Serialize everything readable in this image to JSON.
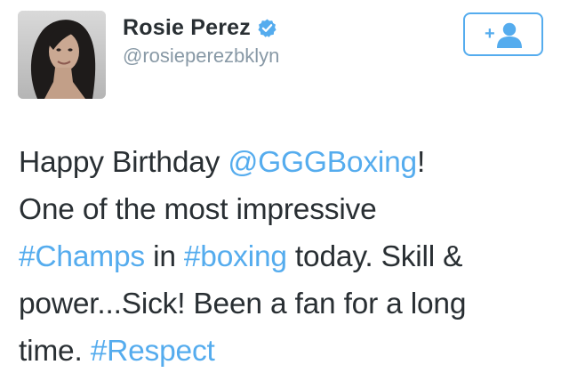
{
  "user": {
    "display_name": "Rosie Perez",
    "handle": "@rosieperezbklyn",
    "verified": true,
    "avatar_icon": "profile-photo"
  },
  "follow_button": {
    "icon": "add-user-icon",
    "label": "+"
  },
  "tweet": {
    "lines": [
      [
        {
          "text": "Happy Birthday ",
          "kind": "text"
        },
        {
          "text": "@GGGBoxing",
          "kind": "mention"
        },
        {
          "text": "!",
          "kind": "text"
        }
      ],
      [
        {
          "text": "One of the most impressive",
          "kind": "text"
        }
      ],
      [
        {
          "text": "#Champs",
          "kind": "hashtag"
        },
        {
          "text": " in ",
          "kind": "text"
        },
        {
          "text": "#boxing",
          "kind": "hashtag"
        },
        {
          "text": " today. Skill &",
          "kind": "text"
        }
      ],
      [
        {
          "text": "power...Sick! Been a fan for a long",
          "kind": "text"
        }
      ],
      [
        {
          "text": "time. ",
          "kind": "text"
        },
        {
          "text": "#Respect",
          "kind": "hashtag"
        }
      ]
    ]
  },
  "colors": {
    "text": "#292f33",
    "secondary": "#8899a6",
    "link": "#55acee",
    "verified_badge": "#55acee"
  }
}
